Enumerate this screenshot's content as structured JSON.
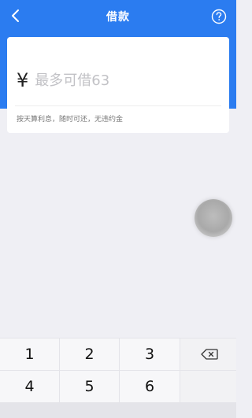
{
  "nav": {
    "title": "借款"
  },
  "loan_card": {
    "currency_symbol": "¥",
    "amount_placeholder": "最多可借63",
    "hint": "按天算利息，随时可还，无违约金"
  },
  "keypad": {
    "keys": [
      "1",
      "2",
      "3",
      "4",
      "5",
      "6"
    ]
  },
  "colors": {
    "brand_blue": "#2b7cf0",
    "background": "#efeff4"
  }
}
